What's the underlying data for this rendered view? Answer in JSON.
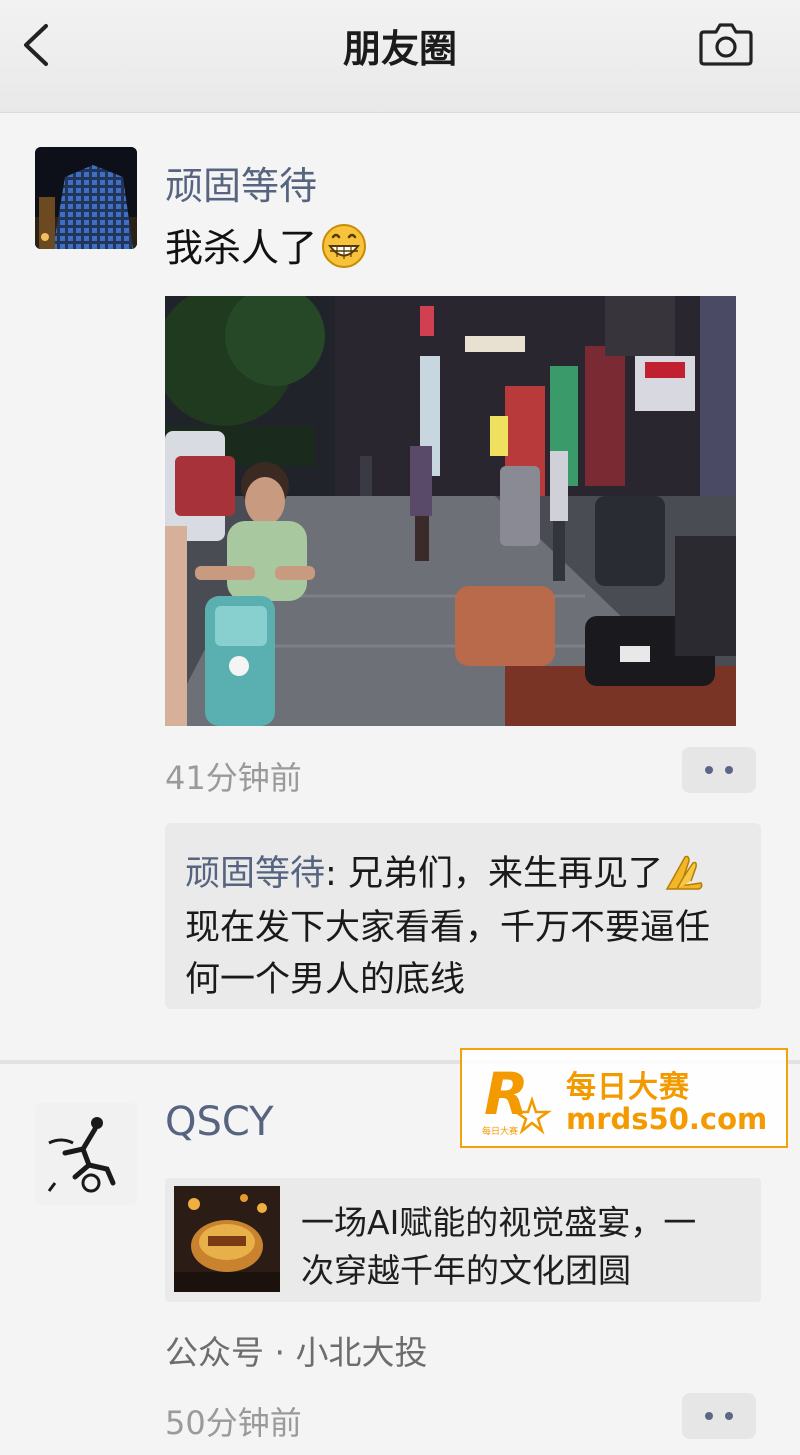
{
  "header": {
    "title": "朋友圈",
    "back_icon": "chevron-left-icon",
    "camera_icon": "camera-icon"
  },
  "posts": [
    {
      "author": "顽固等待",
      "text": "我杀人了",
      "emoji": "grinning-face-icon",
      "time": "41分钟前",
      "comment": {
        "author": "顽固等待",
        "separator": ": ",
        "line1": "兄弟们，来生再见了",
        "line2": "现在发下大家看看，千万不要逼任",
        "line3": "何一个男人的底线",
        "emoji": "praying-hands-icon"
      }
    },
    {
      "author": "QSCY",
      "share": {
        "title_line1": "一场AI赋能的视觉盛宴，一",
        "title_line2": "次穿越千年的文化团圆",
        "source": "公众号 · 小北大投"
      },
      "time": "50分钟前"
    }
  ],
  "watermark": {
    "logo_letter": "R",
    "logo_small": "每日大赛",
    "name": "每日大赛",
    "url": "mrds50.com"
  },
  "colors": {
    "author": "#56647f",
    "accent": "#f39a00",
    "background": "#f4f4f4"
  }
}
